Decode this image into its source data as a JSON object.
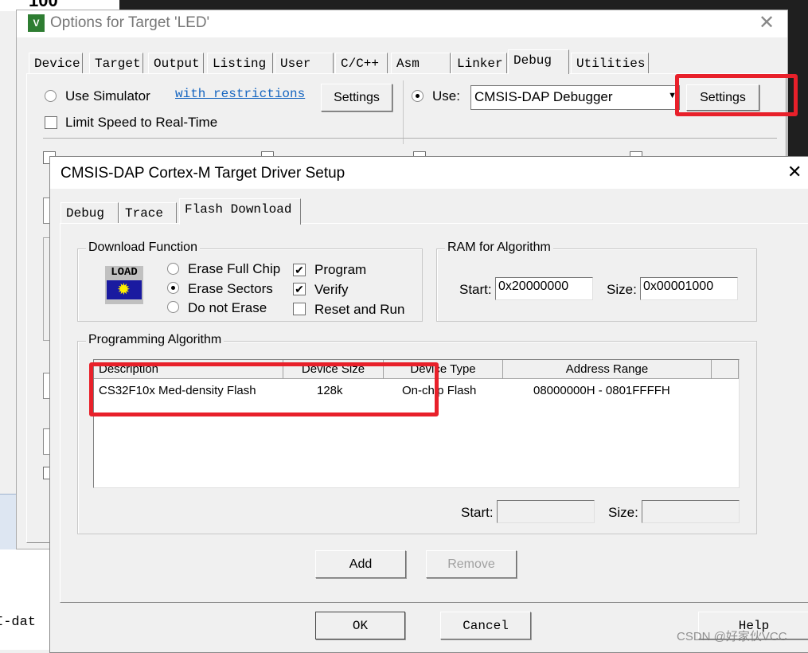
{
  "background": {
    "top_text": "100",
    "bottom_text": "I-dat"
  },
  "outer_dialog": {
    "title": "Options for Target 'LED'",
    "close_icon": "close-icon",
    "tabs": [
      "Device",
      "Target",
      "Output",
      "Listing",
      "User",
      "C/C++",
      "Asm",
      "Linker",
      "Debug",
      "Utilities"
    ],
    "active_tab": "Debug",
    "simulator": {
      "label": "Use Simulator",
      "link": "with restrictions",
      "settings": "Settings",
      "selected": false
    },
    "limit_speed": {
      "label": "Limit Speed to Real-Time",
      "checked": false
    },
    "use": {
      "label": "Use:",
      "selected": true,
      "debugger": "CMSIS-DAP Debugger",
      "settings": "Settings"
    }
  },
  "inner_dialog": {
    "title": "CMSIS-DAP Cortex-M Target Driver Setup",
    "tabs": [
      "Debug",
      "Trace",
      "Flash Download"
    ],
    "active_tab": "Flash Download",
    "download_function": {
      "legend": "Download Function",
      "icon_text": "LOAD",
      "erase_options": [
        {
          "label": "Erase Full Chip",
          "selected": false
        },
        {
          "label": "Erase Sectors",
          "selected": true
        },
        {
          "label": "Do not Erase",
          "selected": false
        }
      ],
      "checks": [
        {
          "label": "Program",
          "checked": true
        },
        {
          "label": "Verify",
          "checked": true
        },
        {
          "label": "Reset and Run",
          "checked": false
        }
      ]
    },
    "ram": {
      "legend": "RAM for Algorithm",
      "start_label": "Start:",
      "start": "0x20000000",
      "size_label": "Size:",
      "size": "0x00001000"
    },
    "algorithm": {
      "legend": "Programming Algorithm",
      "columns": [
        "Description",
        "Device Size",
        "Device Type",
        "Address Range"
      ],
      "rows": [
        [
          "CS32F10x Med-density Flash",
          "128k",
          "On-chip Flash",
          "08000000H - 0801FFFFH"
        ]
      ],
      "start_label": "Start:",
      "start": "",
      "size_label": "Size:",
      "size": ""
    },
    "add": "Add",
    "remove": "Remove",
    "ok": "OK",
    "cancel": "Cancel",
    "help": "Help"
  },
  "highlight_color": "#e8202a",
  "watermark": "CSDN @好家伙VCC"
}
